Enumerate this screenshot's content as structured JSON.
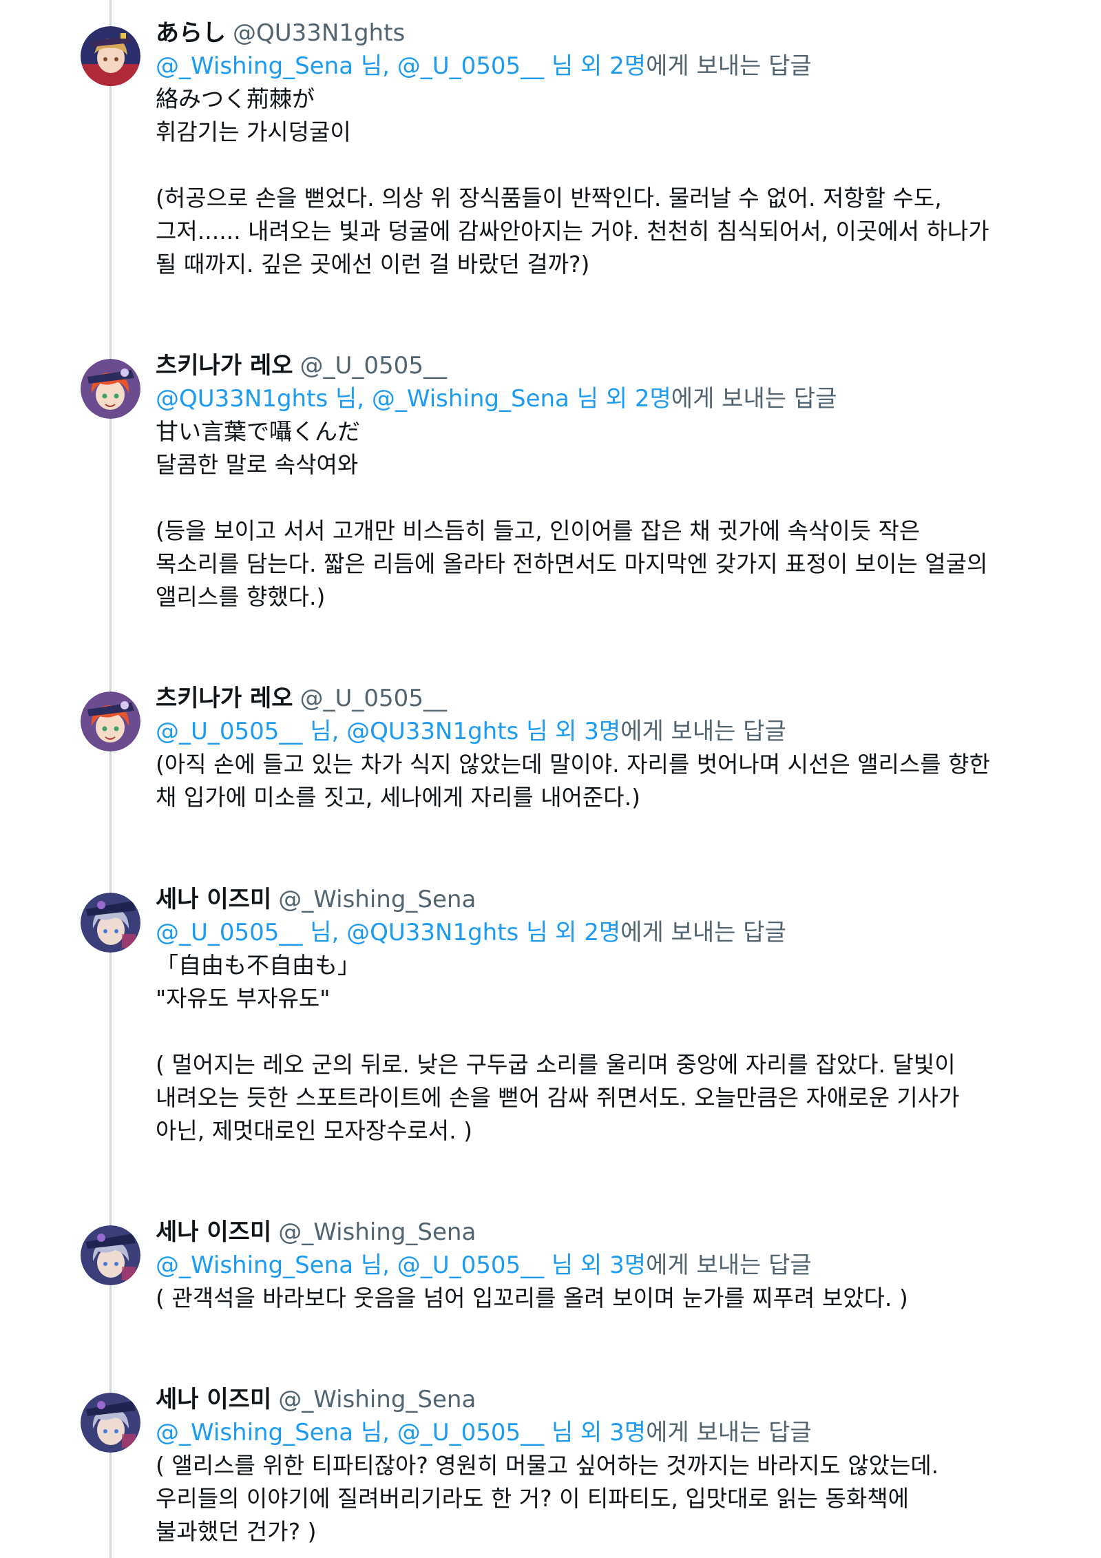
{
  "colors": {
    "link": "#1d9bf0",
    "secondary": "#536471",
    "thread_line": "#cfd9de"
  },
  "tweets": [
    {
      "display_name": "あらし",
      "handle": "@QU33N1ghts",
      "avatar_icon": "avatar-blonde-hat",
      "reply_mentions": "@_Wishing_Sena 님, @_U_0505__ 님 외 2명",
      "reply_suffix": "에게 보내는 답글",
      "lines": [
        "絡みつく荊棘が",
        "휘감기는 가시덩굴이",
        "",
        "(허공으로 손을 뻗었다. 의상 위 장식품들이 반짝인다. 물러날 수 없어. 저항할 수도,",
        "그저...... 내려오는 빛과 덩굴에 감싸안아지는 거야. 천천히 침식되어서, 이곳에서 하나가",
        "될 때까지. 깊은 곳에선 이런 걸 바랐던 걸까?)"
      ]
    },
    {
      "display_name": "츠키나가 레오",
      "handle": "@_U_0505__",
      "avatar_icon": "avatar-orange-hair",
      "reply_mentions": "@QU33N1ghts 님, @_Wishing_Sena 님 외 2명",
      "reply_suffix": "에게 보내는 답글",
      "lines": [
        "甘い言葉で囁くんだ",
        "달콤한 말로 속삭여와",
        "",
        "(등을 보이고 서서 고개만 비스듬히 들고, 인이어를 잡은 채 귓가에 속삭이듯 작은",
        "목소리를 담는다. 짧은 리듬에 올라타 전하면서도 마지막엔 갖가지 표정이 보이는 얼굴의",
        "앨리스를 향했다.)"
      ]
    },
    {
      "display_name": "츠키나가 레오",
      "handle": "@_U_0505__",
      "avatar_icon": "avatar-orange-hair",
      "reply_mentions": "@_U_0505__ 님, @QU33N1ghts 님 외 3명",
      "reply_suffix": "에게 보내는 답글",
      "lines": [
        "(아직 손에 들고 있는 차가 식지 않았는데 말이야. 자리를 벗어나며 시선은 앨리스를 향한",
        "채 입가에 미소를 짓고, 세나에게 자리를 내어준다.)"
      ]
    },
    {
      "display_name": "세나 이즈미",
      "handle": "@_Wishing_Sena",
      "avatar_icon": "avatar-dark-hair",
      "reply_mentions": "@_U_0505__ 님, @QU33N1ghts 님 외 2명",
      "reply_suffix": "에게 보내는 답글",
      "lines": [
        "「自由も不自由も」",
        "\"자유도 부자유도\"",
        "",
        "( 멀어지는 레오 군의 뒤로. 낮은 구두굽 소리를 울리며 중앙에 자리를 잡았다. 달빛이",
        "내려오는 듯한 스포트라이트에 손을 뻗어 감싸 쥐면서도. 오늘만큼은 자애로운 기사가",
        "아닌, 제멋대로인 모자장수로서. )"
      ]
    },
    {
      "display_name": "세나 이즈미",
      "handle": "@_Wishing_Sena",
      "avatar_icon": "avatar-dark-hair",
      "reply_mentions": "@_Wishing_Sena 님, @_U_0505__ 님 외 3명",
      "reply_suffix": "에게 보내는 답글",
      "lines": [
        "( 관객석을 바라보다 웃음을 넘어 입꼬리를 올려 보이며 눈가를 찌푸려 보았다. )"
      ]
    },
    {
      "display_name": "세나 이즈미",
      "handle": "@_Wishing_Sena",
      "avatar_icon": "avatar-dark-hair",
      "reply_mentions": "@_Wishing_Sena 님, @_U_0505__ 님 외 3명",
      "reply_suffix": "에게 보내는 답글",
      "lines": [
        "( 앨리스를 위한 티파티잖아? 영원히 머물고 싶어하는 것까지는 바라지도 않았는데.",
        "우리들의 이야기에 질려버리기라도 한 거? 이 티파티도, 입맛대로 읽는 동화책에",
        "불과했던 건가? )"
      ]
    }
  ]
}
